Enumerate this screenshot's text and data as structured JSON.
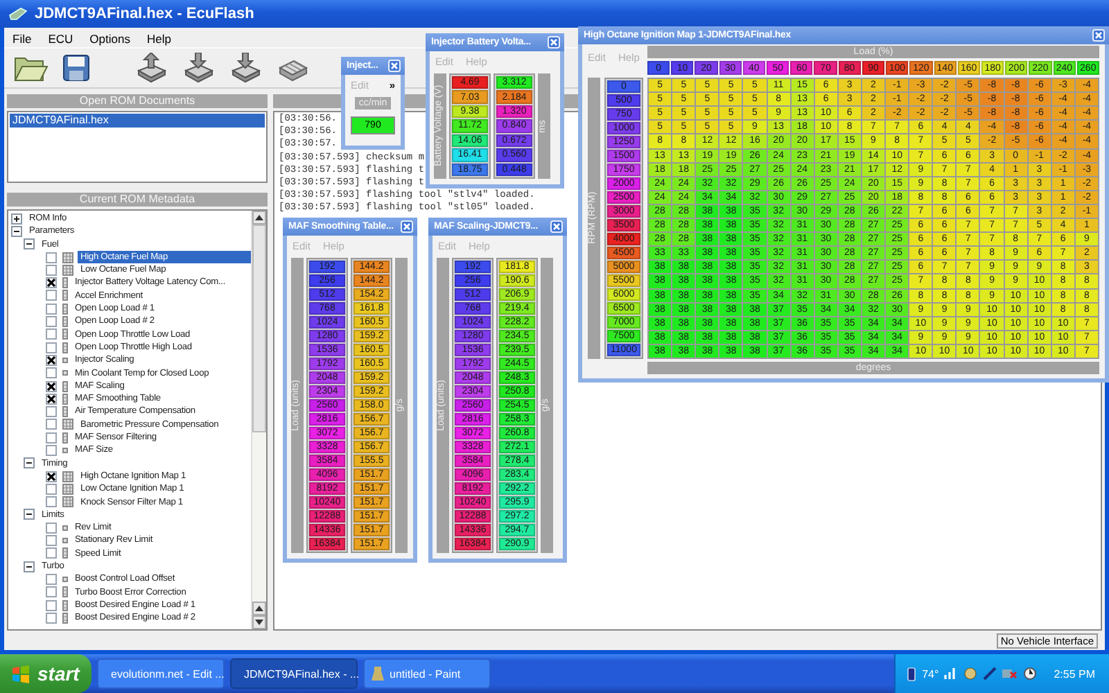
{
  "window": {
    "title": "JDMCT9AFinal.hex - EcuFlash"
  },
  "menu": [
    "File",
    "ECU",
    "Options",
    "Help"
  ],
  "open_documents": {
    "header": "Open ROM Documents",
    "items": [
      {
        "label": "JDMCT9AFinal.hex",
        "selected": true
      }
    ]
  },
  "metadata": {
    "header": "Current ROM Metadata",
    "tree": [
      {
        "label": "ROM Info",
        "kind": "group",
        "expanded": false
      },
      {
        "label": "Parameters",
        "kind": "group",
        "expanded": true,
        "children": [
          {
            "label": "Fuel",
            "kind": "group",
            "expanded": true,
            "children": [
              {
                "label": "High Octane Fuel Map",
                "kind": "map",
                "checked": false,
                "selected": true
              },
              {
                "label": "Low Octane Fuel Map",
                "kind": "map",
                "checked": false,
                "selected": false
              },
              {
                "label": "Injector Battery Voltage Latency Com...",
                "kind": "column",
                "checked": true,
                "selected": false
              },
              {
                "label": "Accel Enrichment",
                "kind": "column",
                "checked": false,
                "selected": false
              },
              {
                "label": "Open Loop Load # 1",
                "kind": "column",
                "checked": false,
                "selected": false
              },
              {
                "label": "Open Loop Load # 2",
                "kind": "column",
                "checked": false,
                "selected": false
              },
              {
                "label": "Open Loop Throttle Low Load",
                "kind": "column",
                "checked": false,
                "selected": false
              },
              {
                "label": "Open Loop Throttle High Load",
                "kind": "column",
                "checked": false,
                "selected": false
              },
              {
                "label": "Injector Scaling",
                "kind": "scalar",
                "checked": true,
                "selected": false
              },
              {
                "label": "Min Coolant Temp for Closed Loop",
                "kind": "scalar",
                "checked": false,
                "selected": false
              },
              {
                "label": "MAF Scaling",
                "kind": "column",
                "checked": true,
                "selected": false
              },
              {
                "label": "MAF Smoothing Table",
                "kind": "column",
                "checked": true,
                "selected": false
              },
              {
                "label": "Air Temperature Compensation",
                "kind": "column",
                "checked": false,
                "selected": false
              },
              {
                "label": "Barometric Pressure Compensation",
                "kind": "map",
                "checked": false,
                "selected": false
              },
              {
                "label": "MAF Sensor Filtering",
                "kind": "column",
                "checked": false,
                "selected": false
              },
              {
                "label": "MAF Size",
                "kind": "scalar",
                "checked": false,
                "selected": false
              }
            ]
          },
          {
            "label": "Timing",
            "kind": "group",
            "expanded": true,
            "children": [
              {
                "label": "High Octane Ignition Map 1",
                "kind": "map",
                "checked": true,
                "selected": false
              },
              {
                "label": "Low Octane Ignition Map 1",
                "kind": "map",
                "checked": false,
                "selected": false
              },
              {
                "label": "Knock Sensor Filter Map 1",
                "kind": "map",
                "checked": false,
                "selected": false
              }
            ]
          },
          {
            "label": "Limits",
            "kind": "group",
            "expanded": true,
            "children": [
              {
                "label": "Rev Limit",
                "kind": "scalar",
                "checked": false,
                "selected": false
              },
              {
                "label": "Stationary Rev Limit",
                "kind": "scalar",
                "checked": false,
                "selected": false
              },
              {
                "label": "Speed Limit",
                "kind": "column",
                "checked": false,
                "selected": false
              }
            ]
          },
          {
            "label": "Turbo",
            "kind": "group",
            "expanded": true,
            "children": [
              {
                "label": "Boost Control Load Offset",
                "kind": "scalar",
                "checked": false,
                "selected": false
              },
              {
                "label": "Turbo Boost Error Correction",
                "kind": "column",
                "checked": false,
                "selected": false
              },
              {
                "label": "Boost Desired Engine Load # 1",
                "kind": "column",
                "checked": false,
                "selected": false
              },
              {
                "label": "Boost Desired Engine Load  # 2",
                "kind": "column",
                "checked": false,
                "selected": false
              }
            ]
          }
        ]
      }
    ]
  },
  "log": {
    "lines": [
      "[03:30:56.",
      "[03:30:56.",
      "[03:30:57.",
      "[03:30:57.593] checksum m",
      "[03:30:57.593] flashing t",
      "[03:30:57.593] flashing t",
      "[03:30:57.593] flashing tool \"stlv4\" loaded.",
      "[03:30:57.593] flashing tool \"stl05\" loaded."
    ]
  },
  "status_bar": {
    "text": "No Vehicle Interface"
  },
  "table_windows": [
    {
      "kind": "scalar",
      "title": "Inject...",
      "menu": [
        {
          "label": "Edit",
          "disabled": true
        },
        {
          "label": "»",
          "disabled": false
        }
      ],
      "unit": "cc/min",
      "value": "790"
    },
    {
      "kind": "column",
      "title": "Injector Battery Volta...",
      "menu": [
        {
          "label": "Edit",
          "disabled": true
        },
        {
          "label": "Help",
          "disabled": true
        }
      ],
      "axis_label": "Battery Voltage (V)",
      "axis": [
        "4.69",
        "7.03",
        "9.38",
        "11.72",
        "14.06",
        "16.41",
        "18.75"
      ],
      "value_label": "ms",
      "values": [
        "3.312",
        "2.184",
        "1.320",
        "0.840",
        "0.672",
        "0.560",
        "0.448"
      ]
    },
    {
      "kind": "map",
      "title": "High Octane Ignition Map 1-JDMCT9AFinal.hex",
      "menu": [
        {
          "label": "Edit",
          "disabled": true
        },
        {
          "label": "Help",
          "disabled": true
        }
      ],
      "x_label": "Load (%)",
      "x_axis": [
        "0",
        "10",
        "20",
        "30",
        "40",
        "50",
        "60",
        "70",
        "80",
        "90",
        "100",
        "120",
        "140",
        "160",
        "180",
        "200",
        "220",
        "240",
        "260"
      ],
      "y_label": "RPM (RPM)",
      "y_axis": [
        "0",
        "500",
        "750",
        "1000",
        "1250",
        "1500",
        "1750",
        "2000",
        "2500",
        "3000",
        "3500",
        "4000",
        "4500",
        "5000",
        "5500",
        "6000",
        "6500",
        "7000",
        "7500",
        "11000"
      ],
      "value_label": "degrees",
      "rows": [
        [
          "5",
          "5",
          "5",
          "5",
          "5",
          "11",
          "15",
          "6",
          "3",
          "2",
          "-1",
          "-3",
          "-2",
          "-5",
          "-8",
          "-8",
          "-6",
          "-3",
          "-4"
        ],
        [
          "5",
          "5",
          "5",
          "5",
          "5",
          "8",
          "13",
          "6",
          "3",
          "2",
          "-1",
          "-2",
          "-2",
          "-5",
          "-8",
          "-8",
          "-6",
          "-4",
          "-4"
        ],
        [
          "5",
          "5",
          "5",
          "5",
          "5",
          "9",
          "13",
          "10",
          "6",
          "2",
          "-2",
          "-2",
          "-2",
          "-5",
          "-8",
          "-8",
          "-6",
          "-4",
          "-4"
        ],
        [
          "5",
          "5",
          "5",
          "5",
          "9",
          "13",
          "18",
          "10",
          "8",
          "7",
          "7",
          "6",
          "4",
          "4",
          "-4",
          "-8",
          "-6",
          "-4",
          "-4"
        ],
        [
          "8",
          "8",
          "12",
          "12",
          "16",
          "20",
          "20",
          "17",
          "15",
          "9",
          "8",
          "7",
          "5",
          "5",
          "-2",
          "-5",
          "-6",
          "-4",
          "-4"
        ],
        [
          "13",
          "13",
          "19",
          "19",
          "26",
          "24",
          "23",
          "21",
          "19",
          "14",
          "10",
          "7",
          "6",
          "6",
          "3",
          "0",
          "-1",
          "-2",
          "-4"
        ],
        [
          "18",
          "18",
          "25",
          "25",
          "27",
          "25",
          "24",
          "23",
          "21",
          "17",
          "12",
          "9",
          "7",
          "7",
          "4",
          "1",
          "3",
          "-1",
          "-3"
        ],
        [
          "24",
          "24",
          "32",
          "32",
          "29",
          "26",
          "26",
          "25",
          "24",
          "20",
          "15",
          "9",
          "8",
          "7",
          "6",
          "3",
          "3",
          "1",
          "-2"
        ],
        [
          "24",
          "24",
          "34",
          "34",
          "32",
          "30",
          "29",
          "27",
          "25",
          "20",
          "18",
          "8",
          "8",
          "6",
          "6",
          "3",
          "3",
          "1",
          "-2"
        ],
        [
          "28",
          "28",
          "38",
          "38",
          "35",
          "32",
          "30",
          "29",
          "28",
          "26",
          "22",
          "7",
          "6",
          "6",
          "7",
          "7",
          "3",
          "2",
          "-1"
        ],
        [
          "28",
          "28",
          "38",
          "38",
          "35",
          "32",
          "31",
          "30",
          "28",
          "27",
          "25",
          "6",
          "6",
          "7",
          "7",
          "7",
          "5",
          "4",
          "1"
        ],
        [
          "28",
          "28",
          "38",
          "38",
          "35",
          "32",
          "31",
          "30",
          "28",
          "27",
          "25",
          "6",
          "6",
          "7",
          "7",
          "8",
          "7",
          "6",
          "9"
        ],
        [
          "33",
          "33",
          "38",
          "38",
          "35",
          "32",
          "31",
          "30",
          "28",
          "27",
          "25",
          "6",
          "6",
          "7",
          "8",
          "9",
          "6",
          "7",
          "2"
        ],
        [
          "38",
          "38",
          "38",
          "38",
          "35",
          "32",
          "31",
          "30",
          "28",
          "27",
          "25",
          "6",
          "7",
          "7",
          "9",
          "9",
          "9",
          "8",
          "3"
        ],
        [
          "38",
          "38",
          "38",
          "38",
          "35",
          "32",
          "31",
          "30",
          "28",
          "27",
          "25",
          "7",
          "8",
          "8",
          "9",
          "9",
          "10",
          "8",
          "8"
        ],
        [
          "38",
          "38",
          "38",
          "38",
          "35",
          "34",
          "32",
          "31",
          "30",
          "28",
          "26",
          "8",
          "8",
          "8",
          "9",
          "10",
          "10",
          "8",
          "8"
        ],
        [
          "38",
          "38",
          "38",
          "38",
          "38",
          "37",
          "35",
          "34",
          "34",
          "32",
          "30",
          "9",
          "9",
          "9",
          "10",
          "10",
          "10",
          "8",
          "8"
        ],
        [
          "38",
          "38",
          "38",
          "38",
          "38",
          "37",
          "36",
          "35",
          "35",
          "34",
          "34",
          "10",
          "9",
          "9",
          "10",
          "10",
          "10",
          "10",
          "7"
        ],
        [
          "38",
          "38",
          "38",
          "38",
          "38",
          "37",
          "36",
          "35",
          "35",
          "34",
          "34",
          "9",
          "9",
          "9",
          "10",
          "10",
          "10",
          "10",
          "7"
        ],
        [
          "38",
          "38",
          "38",
          "38",
          "38",
          "37",
          "36",
          "35",
          "35",
          "34",
          "34",
          "10",
          "10",
          "10",
          "10",
          "10",
          "10",
          "10",
          "7"
        ]
      ]
    },
    {
      "kind": "column",
      "title": "MAF Smoothing Table...",
      "menu": [
        {
          "label": "Edit",
          "disabled": true
        },
        {
          "label": "Help",
          "disabled": true
        }
      ],
      "axis_label": "Load (units)",
      "axis": [
        "192",
        "256",
        "512",
        "768",
        "1024",
        "1280",
        "1536",
        "1792",
        "2048",
        "2304",
        "2560",
        "2816",
        "3072",
        "3328",
        "3584",
        "4096",
        "8192",
        "10240",
        "12288",
        "14336",
        "16384"
      ],
      "value_label": "g/s",
      "values": [
        "144.2",
        "144.2",
        "154.2",
        "161.8",
        "160.5",
        "159.2",
        "160.5",
        "160.5",
        "159.2",
        "159.2",
        "158.0",
        "156.7",
        "156.7",
        "156.7",
        "155.5",
        "151.7",
        "151.7",
        "151.7",
        "151.7",
        "151.7",
        "151.7"
      ]
    },
    {
      "kind": "column",
      "title": "MAF Scaling-JDMCT9...",
      "menu": [
        {
          "label": "Edit",
          "disabled": true
        },
        {
          "label": "Help",
          "disabled": true
        }
      ],
      "axis_label": "Load (units)",
      "axis": [
        "192",
        "256",
        "512",
        "768",
        "1024",
        "1280",
        "1536",
        "1792",
        "2048",
        "2304",
        "2560",
        "2816",
        "3072",
        "3328",
        "3584",
        "4096",
        "8192",
        "10240",
        "12288",
        "14336",
        "16384"
      ],
      "value_label": "g/s",
      "values": [
        "181.8",
        "190.6",
        "206.9",
        "219.4",
        "228.2",
        "234.5",
        "239.5",
        "244.5",
        "248.3",
        "250.8",
        "254.5",
        "258.3",
        "260.8",
        "272.1",
        "278.4",
        "283.4",
        "292.2",
        "295.9",
        "297.2",
        "294.7",
        "290.9"
      ]
    }
  ],
  "taskbar": {
    "start": "start",
    "buttons": [
      {
        "label": "evolutionm.net - Edit ...",
        "selected": false
      },
      {
        "label": "JDMCT9AFinal.hex - ...",
        "selected": true
      },
      {
        "label": "untitled - Paint",
        "selected": false
      }
    ],
    "temperature": "74°",
    "clock": "2:55 PM"
  }
}
